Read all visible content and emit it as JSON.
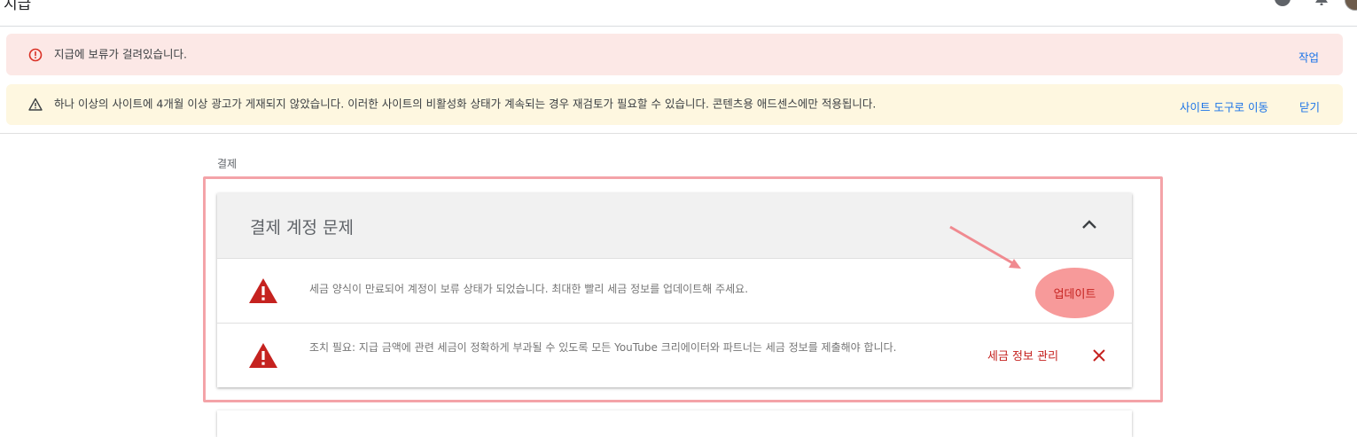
{
  "topbar": {
    "title": "지급"
  },
  "banners": {
    "error": {
      "text": "지급에 보류가 걸려있습니다.",
      "action": "작업"
    },
    "warning": {
      "text": "하나 이상의 사이트에 4개월 이상 광고가 게재되지 않았습니다. 이러한 사이트의 비활성화 상태가 계속되는 경우 재검토가 필요할 수 있습니다. 콘텐츠용 애드센스에만 적용됩니다.",
      "action_site_tool": "사이트 도구로 이동",
      "action_close": "닫기"
    }
  },
  "breadcrumb": "결제",
  "card": {
    "title": "결제 계정 문제",
    "rows": [
      {
        "text": "세금 양식이 만료되어 계정이 보류 상태가 되었습니다. 최대한 빨리 세금 정보를 업데이트해 주세요.",
        "action": "업데이트"
      },
      {
        "text": "조치 필요: 지급 금액에 관련 세금이 정확하게 부과될 수 있도록 모든 YouTube 크리에이터와 파트너는 세금 정보를 제출해야 합니다.",
        "action": "세금 정보 관리"
      }
    ]
  },
  "colors": {
    "error_banner_bg": "#fce8e6",
    "warning_banner_bg": "#fef7e0",
    "link_blue": "#1a73e8",
    "action_red": "#c5221f",
    "highlight_pink": "#f4a3a8",
    "warning_icon_red": "#c5221f"
  },
  "icons": [
    "help-icon",
    "bell-icon",
    "error-icon",
    "warning-icon",
    "chevron-up-icon",
    "close-icon"
  ]
}
